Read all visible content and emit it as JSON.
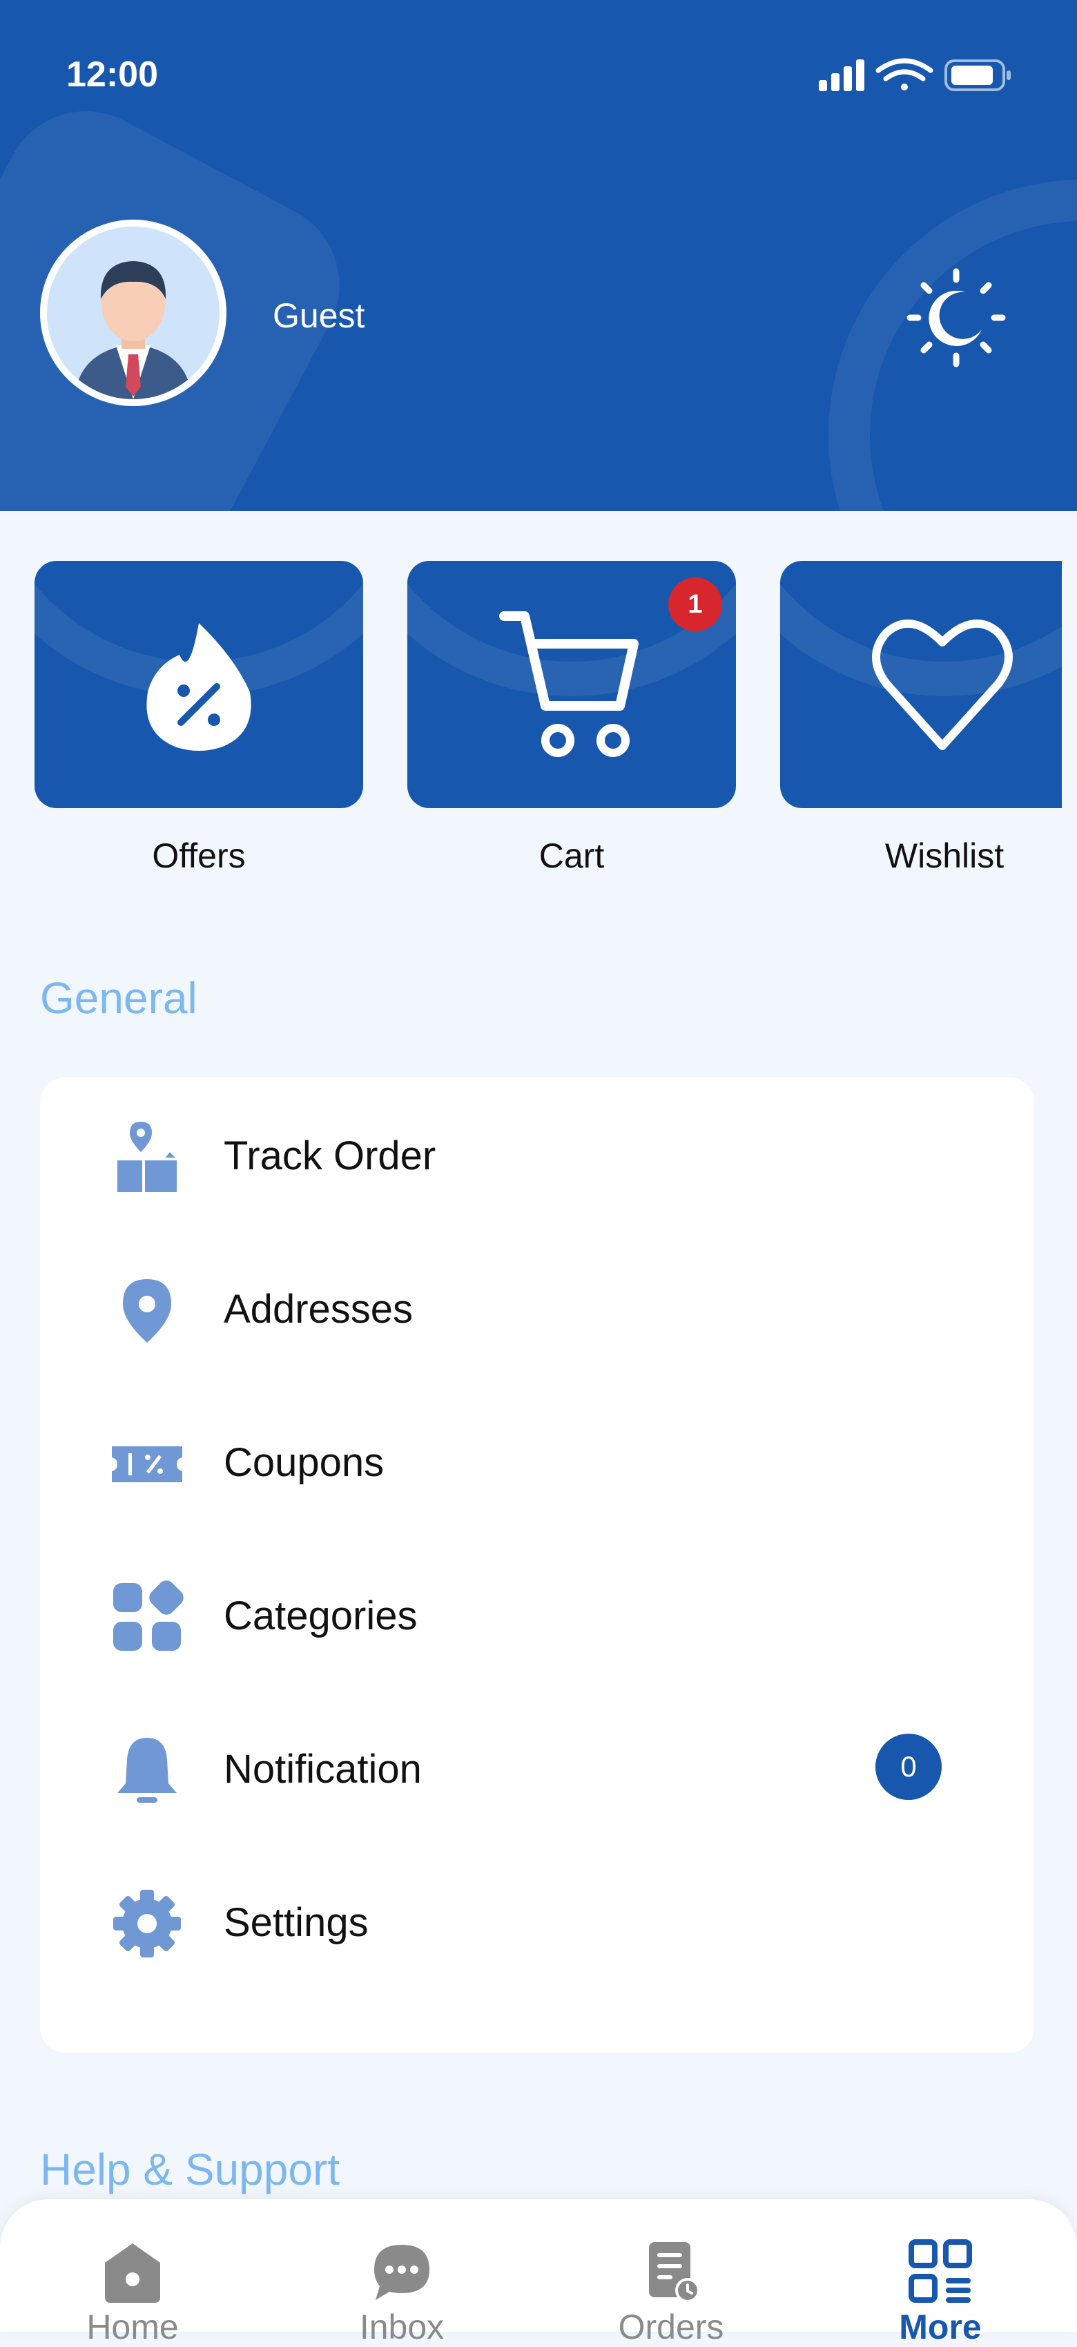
{
  "status_bar": {
    "time": "12:00"
  },
  "profile": {
    "name": "Guest"
  },
  "quick_actions": [
    {
      "label": "Offers",
      "icon": "offers-icon"
    },
    {
      "label": "Cart",
      "icon": "cart-icon",
      "badge": "1"
    },
    {
      "label": "Wishlist",
      "icon": "heart-icon"
    }
  ],
  "sections": {
    "general": "General",
    "help": "Help & Support"
  },
  "general_items": [
    {
      "label": "Track Order",
      "icon": "track-order-icon"
    },
    {
      "label": "Addresses",
      "icon": "location-pin-icon"
    },
    {
      "label": "Coupons",
      "icon": "coupon-icon"
    },
    {
      "label": "Categories",
      "icon": "categories-icon"
    },
    {
      "label": "Notification",
      "icon": "bell-icon",
      "badge": "0"
    },
    {
      "label": "Settings",
      "icon": "gear-icon"
    }
  ],
  "bottom_nav": [
    {
      "label": "Home",
      "icon": "home-icon"
    },
    {
      "label": "Inbox",
      "icon": "chat-icon"
    },
    {
      "label": "Orders",
      "icon": "orders-icon"
    },
    {
      "label": "More",
      "icon": "more-grid-icon",
      "active": true
    }
  ],
  "colors": {
    "primary": "#1757ad",
    "section_title": "#7db7f0",
    "icon_tint": "#6f98d4",
    "badge_red": "#d7262d",
    "background": "#f2f7fd"
  }
}
